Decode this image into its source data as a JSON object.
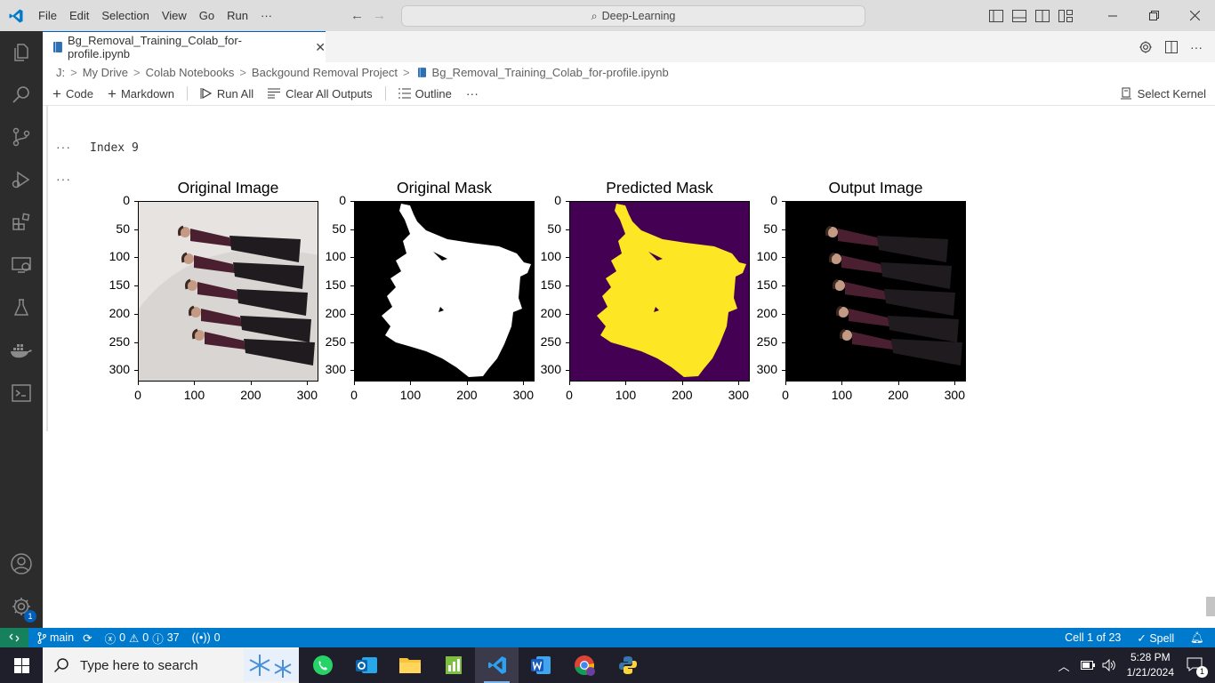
{
  "titlebar": {
    "menu": [
      "File",
      "Edit",
      "Selection",
      "View",
      "Go",
      "Run",
      "···"
    ],
    "search_text": "Deep-Learning"
  },
  "tab": {
    "label": "Bg_Removal_Training_Colab_for-profile.ipynb",
    "close": "✕"
  },
  "breadcrumb": {
    "items": [
      "J:",
      "My Drive",
      "Colab Notebooks",
      "Backgound Removal Project",
      "Bg_Removal_Training_Colab_for-profile.ipynb"
    ],
    "separator": ">"
  },
  "nb_toolbar": {
    "code": "Code",
    "markdown": "Markdown",
    "run_all": "Run All",
    "clear_outputs": "Clear All Outputs",
    "outline": "Outline",
    "more": "···",
    "kernel": "Select Kernel"
  },
  "output": {
    "dots": "···",
    "text": "Index 9"
  },
  "figure": {
    "panels": [
      {
        "title": "Original Image"
      },
      {
        "title": "Original Mask"
      },
      {
        "title": "Predicted Mask"
      },
      {
        "title": "Output Image"
      }
    ],
    "y_ticks": [
      "0",
      "50",
      "100",
      "150",
      "200",
      "250",
      "300"
    ],
    "x_ticks": [
      "0",
      "100",
      "200",
      "300"
    ],
    "colors": {
      "viridis_dark": "#440154",
      "viridis_yellow": "#fde725"
    }
  },
  "activity_badge": "1",
  "statusbar": {
    "branch": "main",
    "errors": "0",
    "warnings": "0",
    "infos": "37",
    "ports": "0",
    "cell": "Cell 1 of 23",
    "spell": "Spell"
  },
  "taskbar": {
    "search_placeholder": "Type here to search",
    "time": "5:28 PM",
    "date": "1/21/2024",
    "notification_count": "1"
  }
}
